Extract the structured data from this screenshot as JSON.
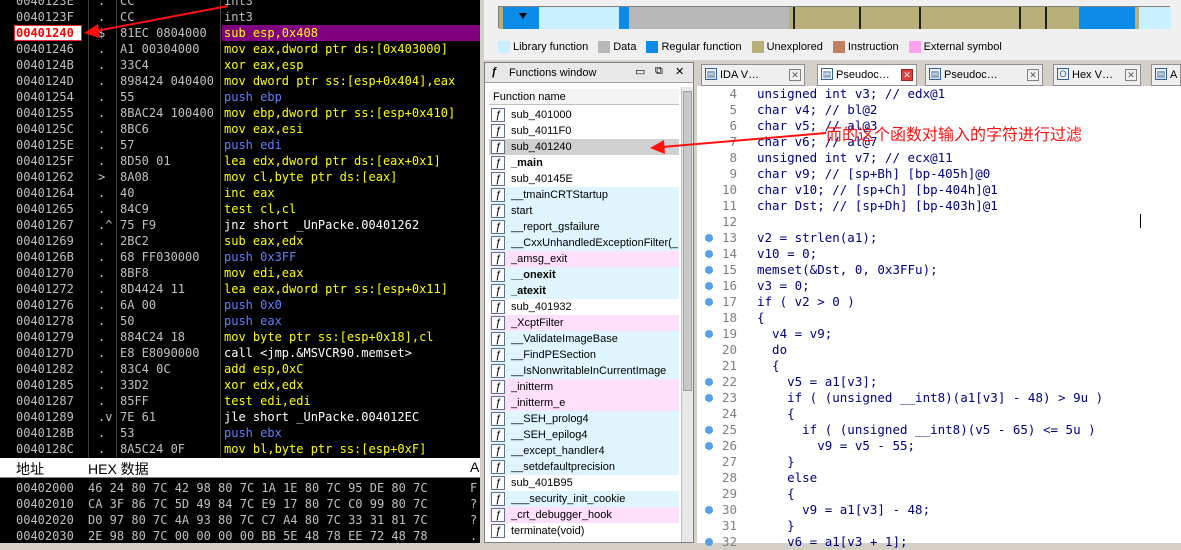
{
  "debugger": {
    "rows": [
      {
        "addr": "0040123E",
        "mark": ".",
        "hex": "CC",
        "asm": "int3"
      },
      {
        "addr": "0040123F",
        "mark": ".",
        "hex": "CC",
        "asm": "int3"
      },
      {
        "addr": "00401240",
        "mark": "$",
        "hex": "81EC 0804000",
        "asm": "sub esp,0x408"
      },
      {
        "addr": "00401246",
        "mark": ".",
        "hex": "A1 00304000",
        "asm": "mov eax,dword ptr ds:[0x403000]"
      },
      {
        "addr": "0040124B",
        "mark": ".",
        "hex": "33C4",
        "asm": "xor eax,esp"
      },
      {
        "addr": "0040124D",
        "mark": ".",
        "hex": "898424 040400",
        "asm": "mov dword ptr ss:[esp+0x404],eax"
      },
      {
        "addr": "00401254",
        "mark": ".",
        "hex": "55",
        "asm": "push ebp"
      },
      {
        "addr": "00401255",
        "mark": ".",
        "hex": "8BAC24 100400",
        "asm": "mov ebp,dword ptr ss:[esp+0x410]"
      },
      {
        "addr": "0040125C",
        "mark": ".",
        "hex": "8BC6",
        "asm": "mov eax,esi"
      },
      {
        "addr": "0040125E",
        "mark": ".",
        "hex": "57",
        "asm": "push edi"
      },
      {
        "addr": "0040125F",
        "mark": ".",
        "hex": "8D50 01",
        "asm": "lea edx,dword ptr ds:[eax+0x1]"
      },
      {
        "addr": "00401262",
        "mark": ">",
        "hex": "8A08",
        "asm": "mov cl,byte ptr ds:[eax]"
      },
      {
        "addr": "00401264",
        "mark": ".",
        "hex": "40",
        "asm": "inc eax"
      },
      {
        "addr": "00401265",
        "mark": ".",
        "hex": "84C9",
        "asm": "test cl,cl"
      },
      {
        "addr": "00401267",
        "mark": ".^",
        "hex": "75 F9",
        "asm": "jnz short _UnPacke.00401262"
      },
      {
        "addr": "00401269",
        "mark": ".",
        "hex": "2BC2",
        "asm": "sub eax,edx"
      },
      {
        "addr": "0040126B",
        "mark": ".",
        "hex": "68 FF030000",
        "asm": "push 0x3FF"
      },
      {
        "addr": "00401270",
        "mark": ".",
        "hex": "8BF8",
        "asm": "mov edi,eax"
      },
      {
        "addr": "00401272",
        "mark": ".",
        "hex": "8D4424 11",
        "asm": "lea eax,dword ptr ss:[esp+0x11]"
      },
      {
        "addr": "00401276",
        "mark": ".",
        "hex": "6A 00",
        "asm": "push 0x0"
      },
      {
        "addr": "00401278",
        "mark": ".",
        "hex": "50",
        "asm": "push eax"
      },
      {
        "addr": "00401279",
        "mark": ".",
        "hex": "884C24 18",
        "asm": "mov byte ptr ss:[esp+0x18],cl"
      },
      {
        "addr": "0040127D",
        "mark": ".",
        "hex": "E8 E8090000",
        "asm": "call <jmp.&MSVCR90.memset>"
      },
      {
        "addr": "00401282",
        "mark": ".",
        "hex": "83C4 0C",
        "asm": "add esp,0xC"
      },
      {
        "addr": "00401285",
        "mark": ".",
        "hex": "33D2",
        "asm": "xor edx,edx"
      },
      {
        "addr": "00401287",
        "mark": ".",
        "hex": "85FF",
        "asm": "test edi,edi"
      },
      {
        "addr": "00401289",
        "mark": ".v",
        "hex": "7E 61",
        "asm": "jle short _UnPacke.004012EC"
      },
      {
        "addr": "0040128B",
        "mark": ".",
        "hex": "53",
        "asm": "push ebx"
      },
      {
        "addr": "0040128C",
        "mark": ".",
        "hex": "8A5C24 0F",
        "asm": "mov bl,byte ptr ss:[esp+0xF]"
      }
    ],
    "selected_index": 2
  },
  "hex_pane": {
    "col_addr": "地址",
    "col_hex": "HEX 数据",
    "col_ascii": "A",
    "rows": [
      {
        "addr": "00402000",
        "bytes": "46 24 80 7C 42 98 80 7C 1A 1E 80 7C 95 DE 80 7C",
        "ascii": "F"
      },
      {
        "addr": "00402010",
        "bytes": "CA 3F 86 7C 5D 49 84 7C E9 17 80 7C C0 99 80 7C",
        "ascii": "?"
      },
      {
        "addr": "00402020",
        "bytes": "D0 97 80 7C 4A 93 80 7C C7 A4 80 7C 33 31 81 7C",
        "ascii": "?"
      },
      {
        "addr": "00402030",
        "bytes": "2E 98 80 7C 00 00 00 00 BB 5E 48 78 EE 72 48 78",
        "ascii": "."
      }
    ]
  },
  "navbar": {
    "legend": [
      {
        "label": "Library function",
        "color": "#c8f0ff"
      },
      {
        "label": "Data",
        "color": "#b8b8b8"
      },
      {
        "label": "Regular function",
        "color": "#0a8ce8"
      },
      {
        "label": "Unexplored",
        "color": "#b8b078"
      },
      {
        "label": "Instruction",
        "color": "#c08060"
      },
      {
        "label": "External symbol",
        "color": "#ffa0f0"
      }
    ]
  },
  "functions_window": {
    "title": "Functions window",
    "column": "Function name",
    "items": [
      {
        "name": "sub_401000",
        "type": "regular"
      },
      {
        "name": "sub_4011F0",
        "type": "regular"
      },
      {
        "name": "sub_401240",
        "type": "selected"
      },
      {
        "name": "_main",
        "type": "regular",
        "bold": true
      },
      {
        "name": "sub_40145E",
        "type": "regular"
      },
      {
        "name": "__tmainCRTStartup",
        "type": "library"
      },
      {
        "name": "start",
        "type": "library"
      },
      {
        "name": "__report_gsfailure",
        "type": "library"
      },
      {
        "name": "__CxxUnhandledExceptionFilter(_",
        "type": "library"
      },
      {
        "name": "_amsg_exit",
        "type": "external"
      },
      {
        "name": "__onexit",
        "type": "library",
        "bold": true
      },
      {
        "name": "_atexit",
        "type": "library",
        "bold": true
      },
      {
        "name": "sub_401932",
        "type": "regular"
      },
      {
        "name": "_XcptFilter",
        "type": "external"
      },
      {
        "name": "__ValidateImageBase",
        "type": "library"
      },
      {
        "name": "__FindPESection",
        "type": "library"
      },
      {
        "name": "__IsNonwritableInCurrentImage",
        "type": "library"
      },
      {
        "name": "_initterm",
        "type": "external"
      },
      {
        "name": "_initterm_e",
        "type": "external"
      },
      {
        "name": "__SEH_prolog4",
        "type": "library"
      },
      {
        "name": "__SEH_epilog4",
        "type": "library"
      },
      {
        "name": "__except_handler4",
        "type": "library"
      },
      {
        "name": "__setdefaultprecision",
        "type": "library"
      },
      {
        "name": "sub_401B95",
        "type": "regular"
      },
      {
        "name": "___security_init_cookie",
        "type": "library"
      },
      {
        "name": "_crt_debugger_hook",
        "type": "external"
      },
      {
        "name": "terminate(void)",
        "type": "regular"
      }
    ]
  },
  "tabs": [
    {
      "label": "IDA V…",
      "active": false
    },
    {
      "label": "Pseudoc…",
      "active": true
    },
    {
      "label": "Pseudoc…",
      "active": false
    },
    {
      "label": "Hex V…",
      "active": false
    },
    {
      "label": "A",
      "active": false
    }
  ],
  "pseudocode": [
    {
      "ln": "4",
      "dot": false,
      "code": "unsigned int v3; // edx@1"
    },
    {
      "ln": "5",
      "dot": false,
      "code": "char v4; // bl@2"
    },
    {
      "ln": "6",
      "dot": false,
      "code": "char v5; // al@3"
    },
    {
      "ln": "7",
      "dot": false,
      "code": "char v6; // al@7"
    },
    {
      "ln": "8",
      "dot": false,
      "code": "unsigned int v7; // ecx@11"
    },
    {
      "ln": "9",
      "dot": false,
      "code": "char v9; // [sp+Bh] [bp-405h]@0"
    },
    {
      "ln": "10",
      "dot": false,
      "code": "char v10; // [sp+Ch] [bp-404h]@1"
    },
    {
      "ln": "11",
      "dot": false,
      "code": "char Dst; // [sp+Dh] [bp-403h]@1"
    },
    {
      "ln": "12",
      "dot": false,
      "code": ""
    },
    {
      "ln": "13",
      "dot": true,
      "code": "v2 = strlen(a1);"
    },
    {
      "ln": "14",
      "dot": true,
      "code": "v10 = 0;"
    },
    {
      "ln": "15",
      "dot": true,
      "code": "memset(&Dst, 0, 0x3FFu);"
    },
    {
      "ln": "16",
      "dot": true,
      "code": "v3 = 0;"
    },
    {
      "ln": "17",
      "dot": true,
      "code": "if ( v2 > 0 )"
    },
    {
      "ln": "18",
      "dot": false,
      "code": "{"
    },
    {
      "ln": "19",
      "dot": true,
      "code": "  v4 = v9;"
    },
    {
      "ln": "20",
      "dot": false,
      "code": "  do"
    },
    {
      "ln": "21",
      "dot": false,
      "code": "  {"
    },
    {
      "ln": "22",
      "dot": true,
      "code": "    v5 = a1[v3];"
    },
    {
      "ln": "23",
      "dot": true,
      "code": "    if ( (unsigned __int8)(a1[v3] - 48) > 9u )"
    },
    {
      "ln": "24",
      "dot": false,
      "code": "    {"
    },
    {
      "ln": "25",
      "dot": true,
      "code": "      if ( (unsigned __int8)(v5 - 65) <= 5u )"
    },
    {
      "ln": "26",
      "dot": true,
      "code": "        v9 = v5 - 55;"
    },
    {
      "ln": "27",
      "dot": false,
      "code": "    }"
    },
    {
      "ln": "28",
      "dot": false,
      "code": "    else"
    },
    {
      "ln": "29",
      "dot": false,
      "code": "    {"
    },
    {
      "ln": "30",
      "dot": true,
      "code": "      v9 = a1[v3] - 48;"
    },
    {
      "ln": "31",
      "dot": false,
      "code": "    }"
    },
    {
      "ln": "32",
      "dot": true,
      "code": "    v6 = a1[v3 + 1];"
    }
  ],
  "annotation": "而的这个函数对输入的字符进行过滤"
}
